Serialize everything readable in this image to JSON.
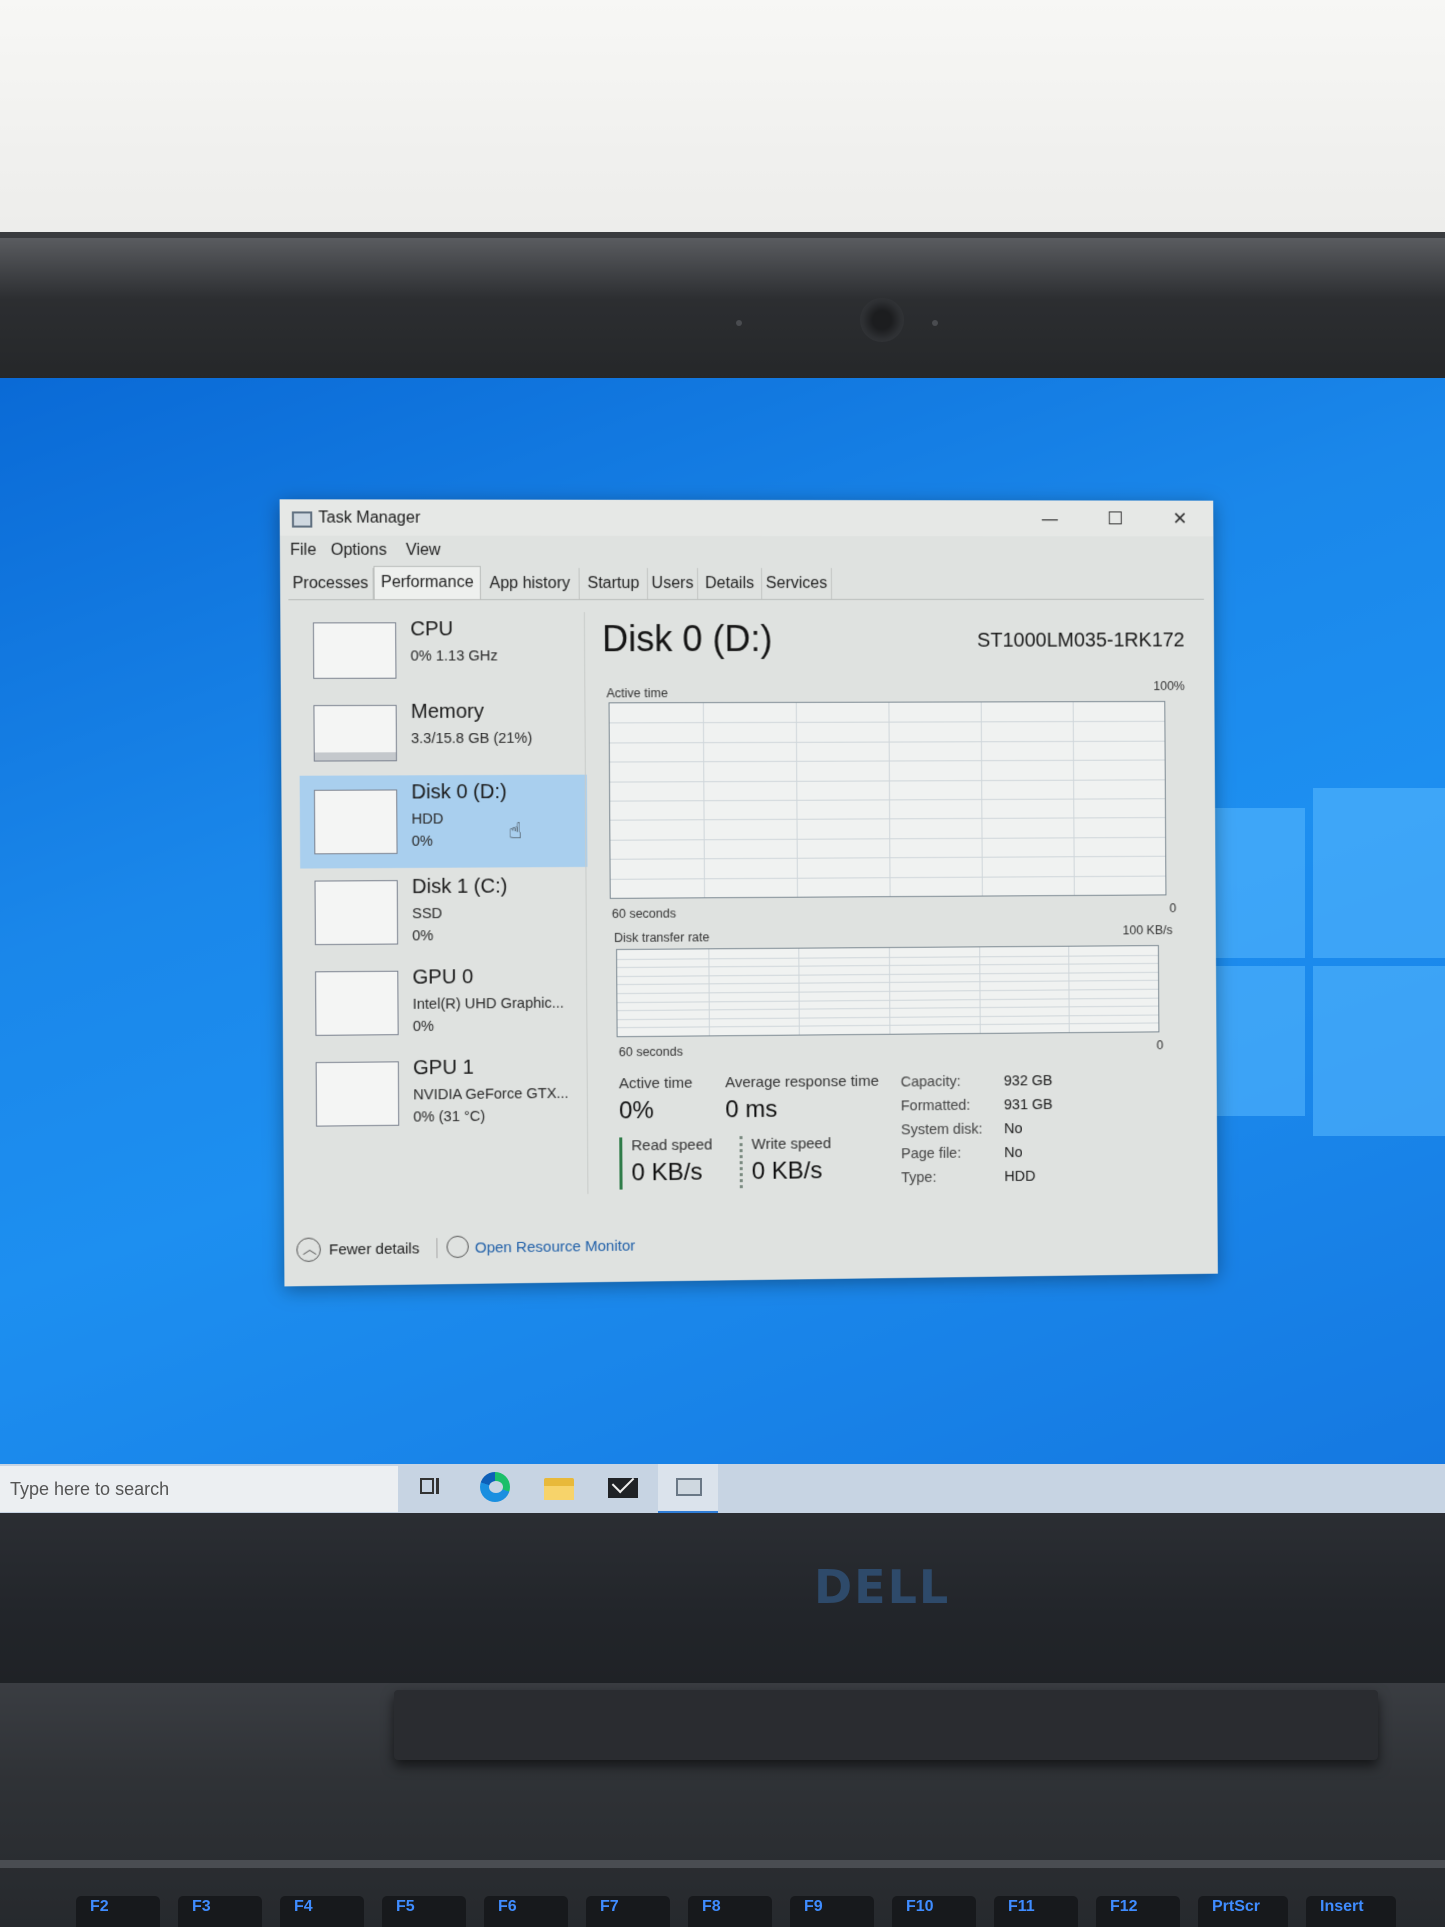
{
  "window": {
    "title": "Task Manager",
    "controls": {
      "minimize": "—",
      "maximize": "☐",
      "close": "✕"
    }
  },
  "menu": [
    "File",
    "Options",
    "View"
  ],
  "tabs": [
    "Processes",
    "Performance",
    "App history",
    "Startup",
    "Users",
    "Details",
    "Services"
  ],
  "active_tab": "Performance",
  "resources": [
    {
      "name": "CPU",
      "line1": "0% 1.13 GHz",
      "line2": ""
    },
    {
      "name": "Memory",
      "line1": "3.3/15.8 GB (21%)",
      "line2": ""
    },
    {
      "name": "Disk 0 (D:)",
      "line1": "HDD",
      "line2": "0%"
    },
    {
      "name": "Disk 1 (C:)",
      "line1": "SSD",
      "line2": "0%"
    },
    {
      "name": "GPU 0",
      "line1": "Intel(R) UHD Graphic...",
      "line2": "0%"
    },
    {
      "name": "GPU 1",
      "line1": "NVIDIA GeForce GTX...",
      "line2": "0% (31 °C)"
    }
  ],
  "selected_resource": "Disk 0 (D:)",
  "detail": {
    "title": "Disk 0 (D:)",
    "model": "ST1000LM035-1RK172",
    "graph1": {
      "label": "Active time",
      "max": "100%",
      "time": "60 seconds",
      "min": "0"
    },
    "graph2": {
      "label": "Disk transfer rate",
      "max": "100 KB/s",
      "time": "60 seconds",
      "min": "0"
    },
    "stats": {
      "active_time_label": "Active time",
      "active_time_value": "0%",
      "avg_response_label": "Average response time",
      "avg_response_value": "0 ms",
      "read_label": "Read speed",
      "read_value": "0 KB/s",
      "write_label": "Write speed",
      "write_value": "0 KB/s"
    },
    "properties": [
      {
        "key": "Capacity:",
        "value": "932 GB"
      },
      {
        "key": "Formatted:",
        "value": "931 GB"
      },
      {
        "key": "System disk:",
        "value": "No"
      },
      {
        "key": "Page file:",
        "value": "No"
      },
      {
        "key": "Type:",
        "value": "HDD"
      }
    ]
  },
  "footer": {
    "fewer_details": "Fewer details",
    "resource_monitor": "Open Resource Monitor"
  },
  "taskbar": {
    "search_placeholder": "Type here to search",
    "icons": [
      "task-view-icon",
      "edge-icon",
      "file-explorer-icon",
      "mail-icon",
      "task-manager-icon"
    ]
  },
  "laptop": {
    "brand": "DELL",
    "keys": [
      "F2",
      "F3",
      "F4",
      "F5",
      "F6",
      "F7",
      "F8",
      "F9",
      "F10",
      "F11",
      "F12",
      "PrtScr",
      "Insert"
    ]
  },
  "colors": {
    "selected": "#a9cfee",
    "link": "#1f5fa8",
    "desktop": "#1a87ea",
    "key_legend": "#3f8cff"
  }
}
